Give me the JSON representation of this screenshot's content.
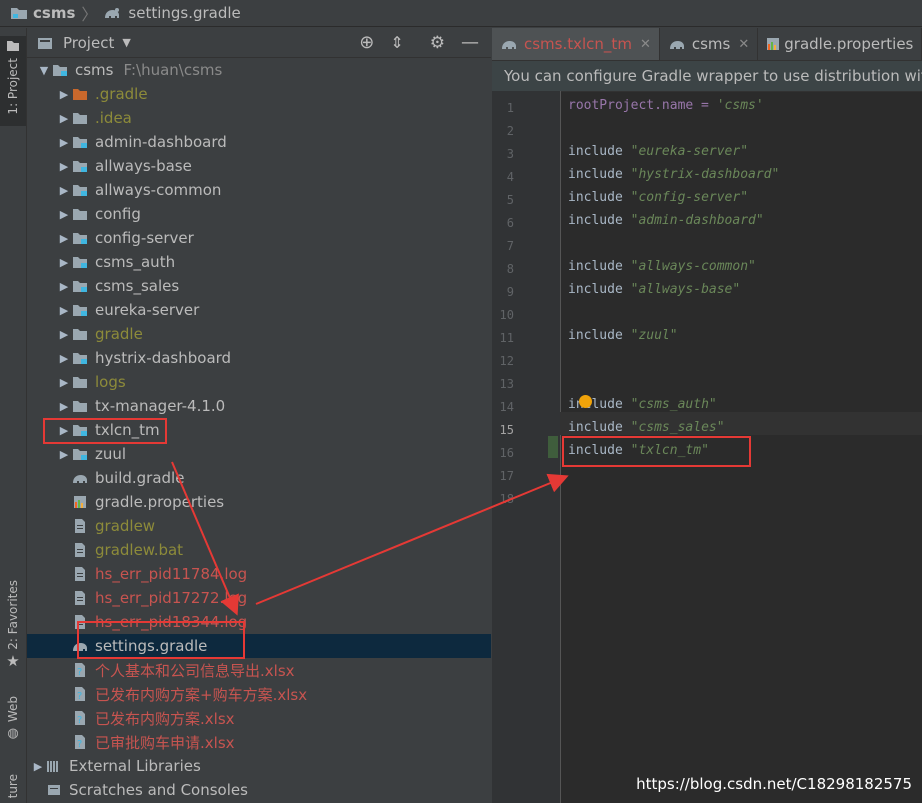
{
  "breadcrumb": {
    "project": "csms",
    "file": "settings.gradle"
  },
  "left_stripe": {
    "project_tab": "1: Project",
    "favorites_tab": "2: Favorites",
    "web_tab": "Web",
    "structure_tab": "ture"
  },
  "project_panel": {
    "title": "Project",
    "root": {
      "name": "csms",
      "path": "F:\\huan\\csms"
    },
    "items": [
      {
        "label": ".gradle",
        "style": "olive",
        "kind": "folder-orange"
      },
      {
        "label": ".idea",
        "style": "olive",
        "kind": "folder"
      },
      {
        "label": "admin-dashboard",
        "style": "normal",
        "kind": "module"
      },
      {
        "label": "allways-base",
        "style": "normal",
        "kind": "module"
      },
      {
        "label": "allways-common",
        "style": "normal",
        "kind": "module"
      },
      {
        "label": "config",
        "style": "normal",
        "kind": "folder"
      },
      {
        "label": "config-server",
        "style": "normal",
        "kind": "module"
      },
      {
        "label": "csms_auth",
        "style": "normal",
        "kind": "module"
      },
      {
        "label": "csms_sales",
        "style": "normal",
        "kind": "module"
      },
      {
        "label": "eureka-server",
        "style": "normal",
        "kind": "module"
      },
      {
        "label": "gradle",
        "style": "olive",
        "kind": "folder"
      },
      {
        "label": "hystrix-dashboard",
        "style": "normal",
        "kind": "module"
      },
      {
        "label": "logs",
        "style": "olive",
        "kind": "folder"
      },
      {
        "label": "tx-manager-4.1.0",
        "style": "normal",
        "kind": "folder"
      },
      {
        "label": "txlcn_tm",
        "style": "normal",
        "kind": "module"
      },
      {
        "label": "zuul",
        "style": "normal",
        "kind": "module"
      },
      {
        "label": "build.gradle",
        "style": "normal",
        "kind": "gradle"
      },
      {
        "label": "gradle.properties",
        "style": "normal",
        "kind": "props"
      },
      {
        "label": "gradlew",
        "style": "olive",
        "kind": "file"
      },
      {
        "label": "gradlew.bat",
        "style": "olive",
        "kind": "file"
      },
      {
        "label": "hs_err_pid11784.log",
        "style": "red",
        "kind": "file"
      },
      {
        "label": "hs_err_pid17272.log",
        "style": "red",
        "kind": "file"
      },
      {
        "label": "hs_err_pid18344.log",
        "style": "red",
        "kind": "file"
      },
      {
        "label": "settings.gradle",
        "style": "normal",
        "kind": "gradle"
      },
      {
        "label": "个人基本和公司信息导出.xlsx",
        "style": "red",
        "kind": "unknown"
      },
      {
        "label": "已发布内购方案+购车方案.xlsx",
        "style": "red",
        "kind": "unknown"
      },
      {
        "label": "已发布内购方案.xlsx",
        "style": "red",
        "kind": "unknown"
      },
      {
        "label": "已审批购车申请.xlsx",
        "style": "red",
        "kind": "unknown"
      }
    ],
    "external_libraries": "External Libraries",
    "scratches": "Scratches and Consoles"
  },
  "editor": {
    "tabs": [
      {
        "label": "csms.txlcn_tm",
        "active": true
      },
      {
        "label": "csms",
        "active": false
      },
      {
        "label": "gradle.properties",
        "active": false
      }
    ],
    "notice": "You can configure Gradle wrapper to use distribution with",
    "lines": [
      {
        "n": "1",
        "kw": "rootProject.name = ",
        "str": "'csms'"
      },
      {
        "n": "2",
        "kw": "",
        "str": ""
      },
      {
        "n": "3",
        "kw": "include ",
        "str": "\"eureka-server\""
      },
      {
        "n": "4",
        "kw": "include ",
        "str": "\"hystrix-dashboard\""
      },
      {
        "n": "5",
        "kw": "include ",
        "str": "\"config-server\""
      },
      {
        "n": "6",
        "kw": "include ",
        "str": "\"admin-dashboard\""
      },
      {
        "n": "7",
        "kw": "",
        "str": ""
      },
      {
        "n": "8",
        "kw": "include ",
        "str": "\"allways-common\""
      },
      {
        "n": "9",
        "kw": "include ",
        "str": "\"allways-base\""
      },
      {
        "n": "10",
        "kw": "",
        "str": ""
      },
      {
        "n": "11",
        "kw": "include ",
        "str": "\"zuul\""
      },
      {
        "n": "12",
        "kw": "",
        "str": ""
      },
      {
        "n": "13",
        "kw": "",
        "str": ""
      },
      {
        "n": "14",
        "kw": "include ",
        "str": "\"csms_auth\""
      },
      {
        "n": "15",
        "kw": "include ",
        "str": "\"csms_sales\""
      },
      {
        "n": "16",
        "kw": "include ",
        "str": "\"txlcn_tm\""
      },
      {
        "n": "17",
        "kw": "",
        "str": ""
      },
      {
        "n": "18",
        "kw": "",
        "str": ""
      }
    ]
  },
  "watermark": "https://blog.csdn.net/C18298182575",
  "colors": {
    "annotation": "#e53935",
    "selection": "#0d293e",
    "olive": "#8d8b3a",
    "red": "#c75450"
  }
}
